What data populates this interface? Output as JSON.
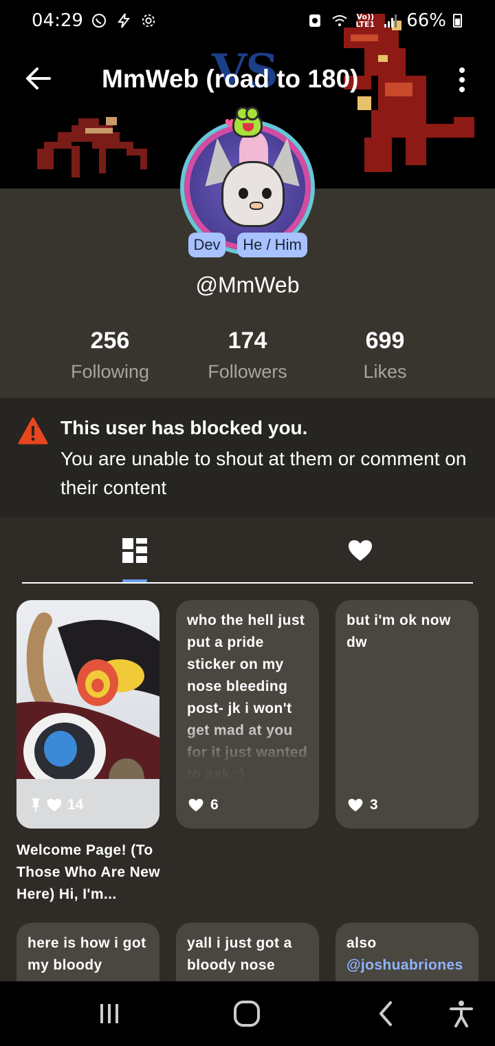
{
  "status_bar": {
    "time": "04:29",
    "battery": "66%",
    "network": "LTE1",
    "volte": "Vo))"
  },
  "header": {
    "title": "MmWeb (road to 180)",
    "banner_text": "VS"
  },
  "profile": {
    "badges": [
      "Dev",
      "He / Him"
    ],
    "handle": "@MmWeb",
    "stats": [
      {
        "value": "256",
        "label": "Following"
      },
      {
        "value": "174",
        "label": "Followers"
      },
      {
        "value": "699",
        "label": "Likes"
      }
    ]
  },
  "notice": {
    "title": "This user has blocked you.",
    "body": "You are unable to shout at them or comment on their content"
  },
  "tabs": [
    {
      "name": "posts-grid",
      "icon": "grid-icon"
    },
    {
      "name": "likes",
      "icon": "heart-icon"
    }
  ],
  "posts": [
    {
      "type": "image",
      "likes": "14",
      "pinned": true,
      "caption": "Welcome Page! (To Those Who Are New Here) Hi, I'm..."
    },
    {
      "type": "text",
      "likes": "6",
      "text": "who the hell just put a pride sticker on my nose bleeding post- jk i won't get mad at you for it just wanted to ask :)"
    },
    {
      "type": "text",
      "likes": "3",
      "text": "but i'm ok now dw"
    },
    {
      "type": "text",
      "text": "here is how i got my bloody"
    },
    {
      "type": "text",
      "text": "yall i just got a bloody nose"
    },
    {
      "type": "text",
      "text": "also",
      "mention": "@joshuabriones"
    }
  ],
  "colors": {
    "background": "#2f2c28",
    "card": "#4a4640",
    "badge": "#a8c2ff",
    "warning": "#e8461e",
    "accent": "#6aa0f0"
  }
}
